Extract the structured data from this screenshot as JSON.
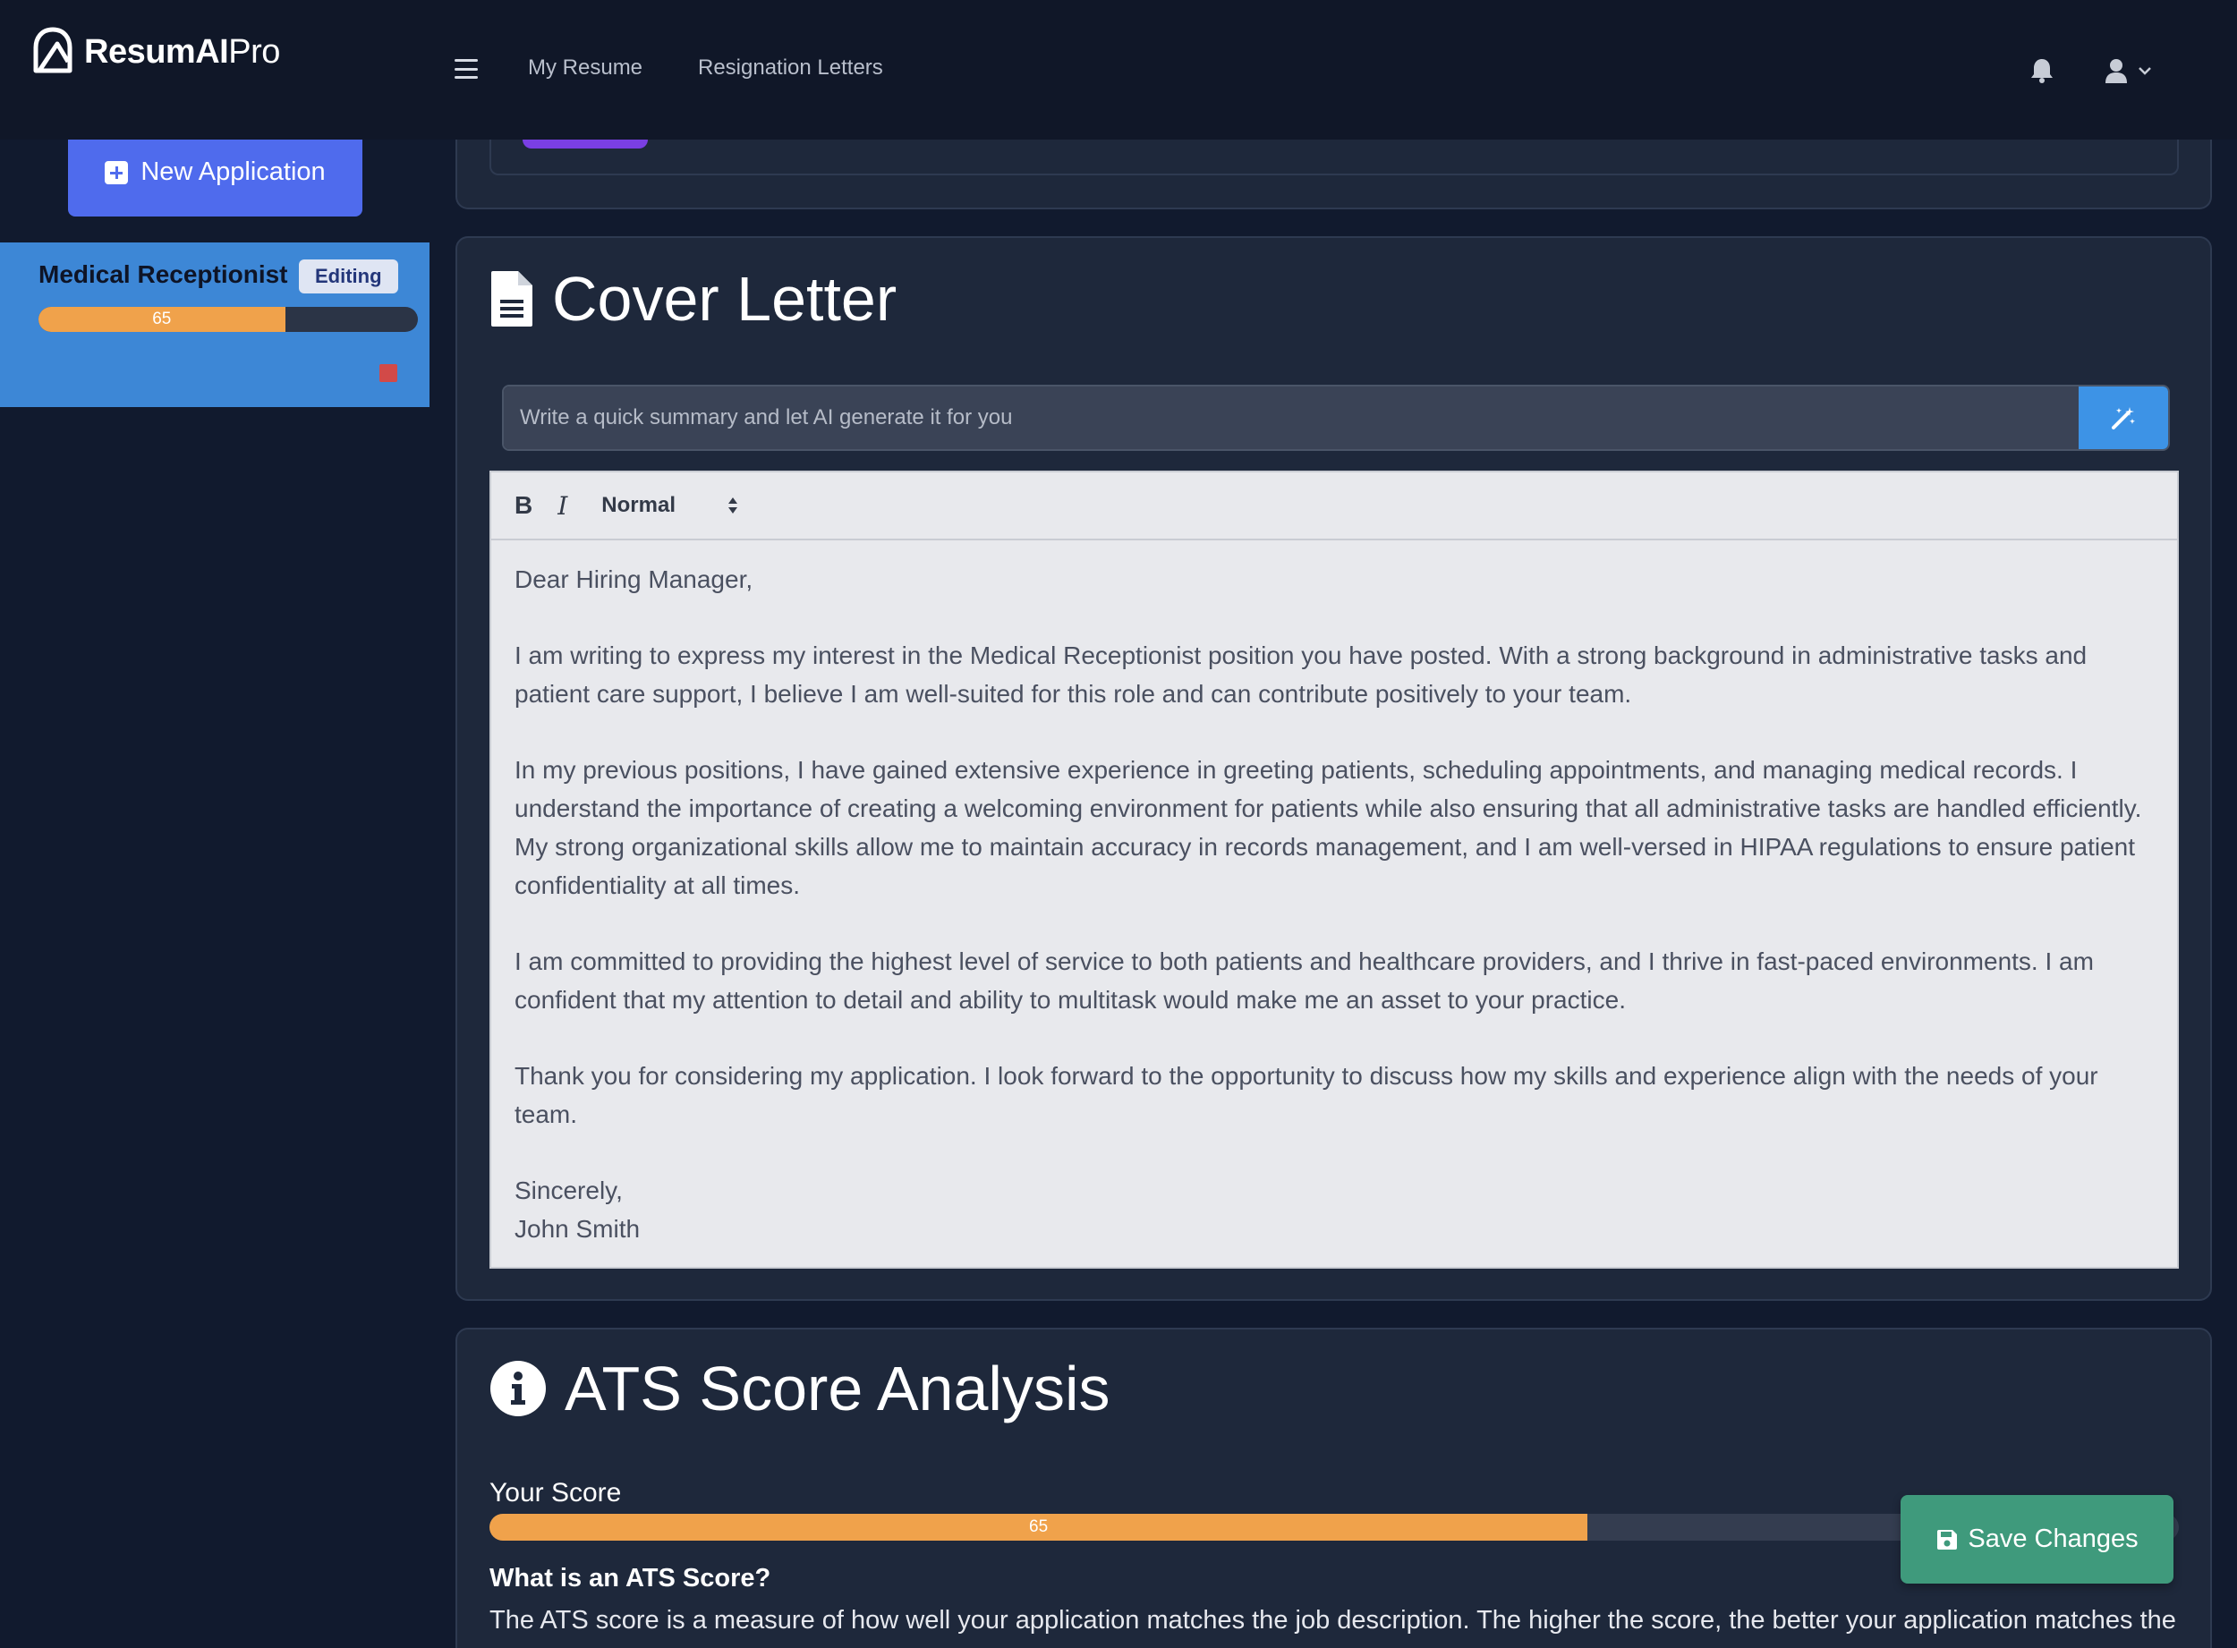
{
  "brand": {
    "name_bold": "Resum",
    "name_ai": "AI",
    "name_rest": "Pro"
  },
  "nav": {
    "links": [
      "My Resume",
      "Resignation Letters"
    ]
  },
  "sidebar": {
    "new_application_label": "New Application",
    "applications": [
      {
        "title": "Medical Receptionist",
        "badge": "Editing",
        "score": 65,
        "score_label": "65"
      }
    ]
  },
  "cover_letter": {
    "title": "Cover Letter",
    "ai_placeholder": "Write a quick summary and let AI generate it for you",
    "toolbar": {
      "bold": "B",
      "italic": "I",
      "format": "Normal"
    },
    "body": {
      "greeting": "Dear Hiring Manager,",
      "p1": "I am writing to express my interest in the Medical Receptionist position you have posted. With a strong background in administrative tasks and patient care support, I believe I am well-suited for this role and can contribute positively to your team.",
      "p2": "In my previous positions, I have gained extensive experience in greeting patients, scheduling appointments, and managing medical records. I understand the importance of creating a welcoming environment for patients while also ensuring that all administrative tasks are handled efficiently. My strong organizational skills allow me to maintain accuracy in records management, and I am well-versed in HIPAA regulations to ensure patient confidentiality at all times.",
      "p3": "I am committed to providing the highest level of service to both patients and healthcare providers, and I thrive in fast-paced environments. I am confident that my attention to detail and ability to multitask would make me an asset to your practice.",
      "p4": "Thank you for considering my application. I look forward to the opportunity to discuss how my skills and experience align with the needs of your team.",
      "closing": "Sincerely,",
      "signature": "John Smith"
    }
  },
  "ats": {
    "title": "ATS Score Analysis",
    "score_label": "Your Score",
    "score": 65,
    "score_text": "65",
    "question": "What is an ATS Score?",
    "description": "The ATS score is a measure of how well your application matches the job description. The higher the score, the better your application matches the job description."
  },
  "actions": {
    "save_label": "Save Changes"
  },
  "colors": {
    "background": "#111a2e",
    "panel": "#1e283b",
    "primary": "#4f6bed",
    "active_card": "#3d87d6",
    "progress": "#f0a24b",
    "save": "#3f9a7c",
    "ai_button": "#3d93e6"
  },
  "icons": {
    "logo": "logo-mark-icon",
    "menu": "hamburger-icon",
    "notifications": "bell-icon",
    "user": "user-icon",
    "dropdown": "chevron-down-icon",
    "new": "plus-square-icon",
    "delete": "trash-icon",
    "cover": "file-text-icon",
    "ai": "magic-wand-icon",
    "ats": "info-circle-icon",
    "save": "floppy-disk-icon"
  }
}
